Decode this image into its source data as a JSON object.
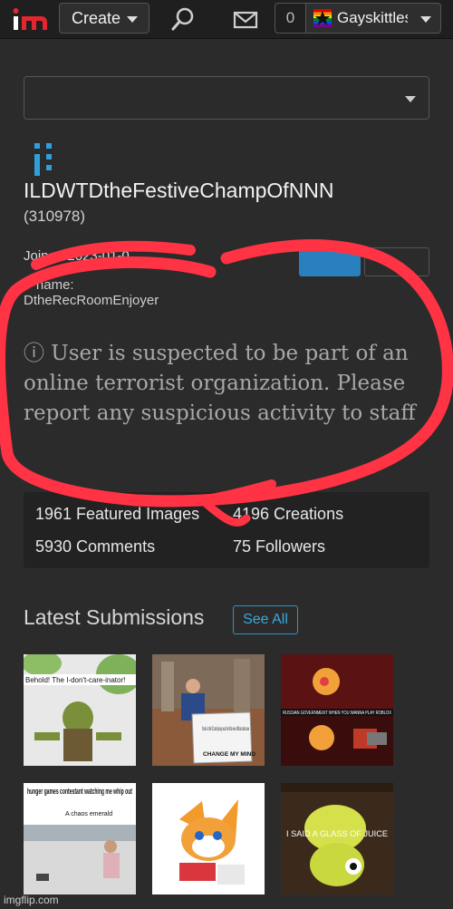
{
  "nav": {
    "create_label": "Create",
    "notification_count": "0",
    "username": "Gayskittles"
  },
  "profile": {
    "name": "ILDWTDtheFestiveChampOfNNN",
    "id": "(310978)",
    "joined": "Joined 2023-01-0",
    "previous_label": "P                   name:",
    "previous_value": "DtheRecRoomEnjoyer",
    "warning": "ⓘ User is suspected to be part of an online terrorist organization. Please report any suspicious activity to staff"
  },
  "stats": {
    "featured": "1961 Featured Images",
    "creations": "4196 Creations",
    "comments": "5930 Comments",
    "followers": "75 Followers"
  },
  "submissions": {
    "title": "Latest Submissions",
    "see_all": "See All",
    "thumb_texts": [
      "Behold! The I-don't-care-inator!",
      "Sonic is the S2 anti-piracy was the first ever official sonic.exe",
      "CHANGE MY MIND",
      "RUSSIAN GOVERNMENT WHEN YOU WANNA PLAY ROBLOX",
      "hunger games contestant watching me whip out",
      "A chaos emerald",
      "I SAID A GLASS OF JUICE"
    ]
  },
  "footer": {
    "watermark": "imgflip.com"
  },
  "colors": {
    "accent": "#3aa8de",
    "scribble": "#ff3344",
    "logo_red": "#e5262f"
  }
}
